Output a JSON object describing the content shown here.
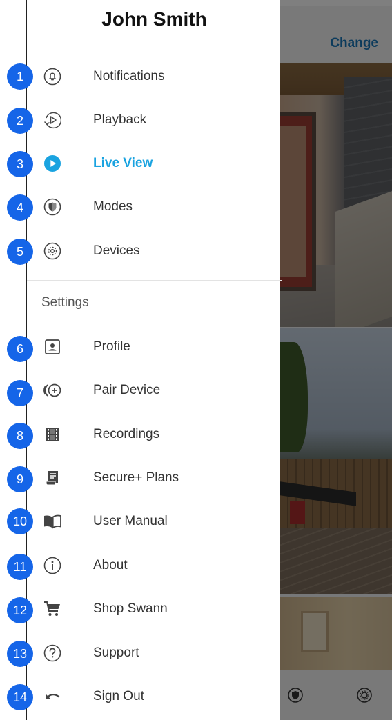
{
  "user": {
    "name": "John Smith"
  },
  "background": {
    "change_label": "Change"
  },
  "menu": {
    "items": [
      {
        "label": "Notifications",
        "icon": "bell-icon"
      },
      {
        "label": "Playback",
        "icon": "playback-icon"
      },
      {
        "label": "Live View",
        "icon": "live-view-icon",
        "active": true
      },
      {
        "label": "Modes",
        "icon": "shield-icon"
      },
      {
        "label": "Devices",
        "icon": "gear-icon"
      }
    ]
  },
  "settings": {
    "label": "Settings",
    "items": [
      {
        "label": "Profile",
        "icon": "profile-icon"
      },
      {
        "label": "Pair Device",
        "icon": "pair-device-icon"
      },
      {
        "label": "Recordings",
        "icon": "film-icon"
      },
      {
        "label": "Secure+ Plans",
        "icon": "plans-icon"
      },
      {
        "label": "User Manual",
        "icon": "book-icon"
      },
      {
        "label": "About",
        "icon": "info-icon"
      },
      {
        "label": "Shop Swann",
        "icon": "cart-icon"
      },
      {
        "label": "Support",
        "icon": "question-icon"
      },
      {
        "label": "Sign Out",
        "icon": "undo-arrow-icon"
      }
    ]
  },
  "badges": [
    "1",
    "2",
    "3",
    "4",
    "5",
    "6",
    "7",
    "8",
    "9",
    "10",
    "11",
    "12",
    "13",
    "14"
  ],
  "colors": {
    "active": "#1aa3e0",
    "badge": "#1565e8",
    "icon": "#444444"
  }
}
